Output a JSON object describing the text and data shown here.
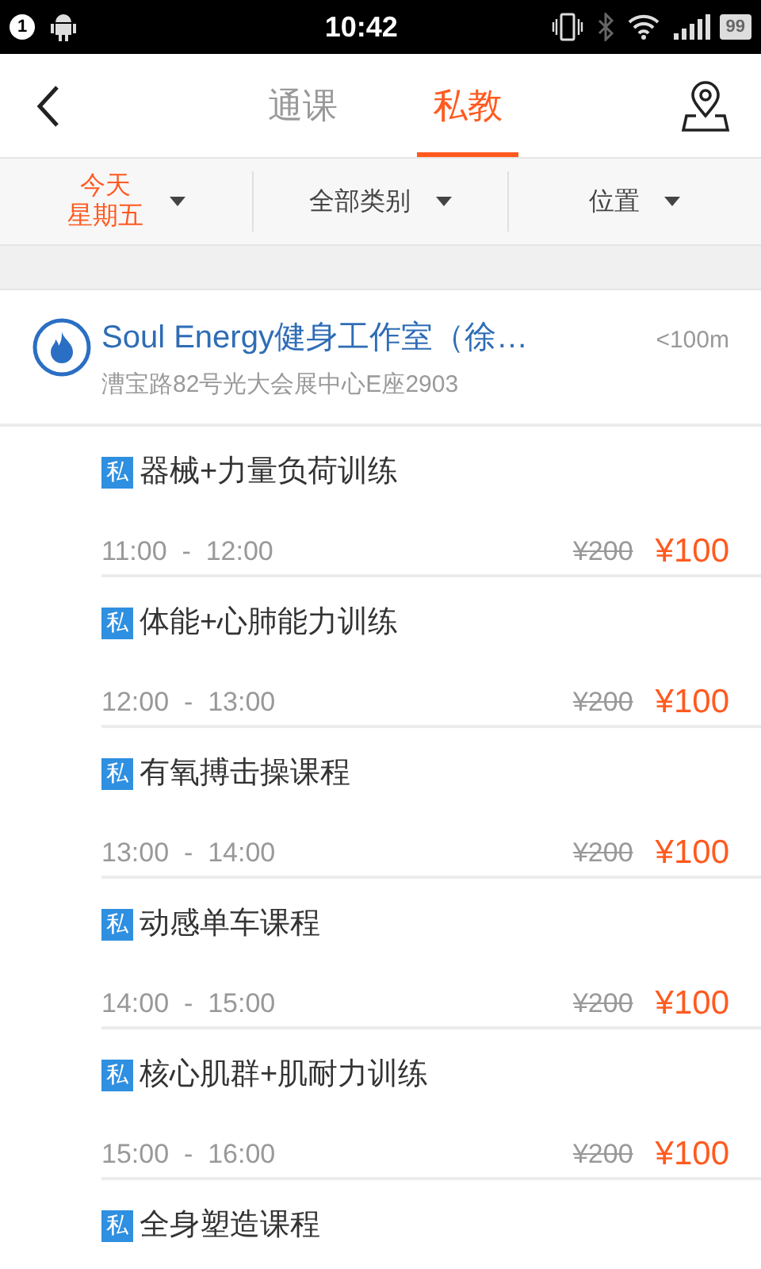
{
  "status_bar": {
    "notification_count": "1",
    "time": "10:42",
    "battery": "99"
  },
  "tabs": [
    {
      "label": "通课",
      "selected": false
    },
    {
      "label": "私教",
      "selected": true
    }
  ],
  "filters": [
    {
      "label": "今天",
      "sublabel": "星期五",
      "selected": true
    },
    {
      "label": "全部类别",
      "selected": false
    },
    {
      "label": "位置",
      "selected": false
    }
  ],
  "gym": {
    "name": "Soul Energy健身工作室（徐…",
    "address": "漕宝路82号光大会展中心E座2903",
    "distance": "<100m"
  },
  "courses": [
    {
      "tag": "私",
      "title": "器械+力量负荷训练",
      "time": "11:00  -  12:00",
      "original_price": "¥200",
      "price": "¥100"
    },
    {
      "tag": "私",
      "title": "体能+心肺能力训练",
      "time": "12:00  -  13:00",
      "original_price": "¥200",
      "price": "¥100"
    },
    {
      "tag": "私",
      "title": "有氧搏击操课程",
      "time": "13:00  -  14:00",
      "original_price": "¥200",
      "price": "¥100"
    },
    {
      "tag": "私",
      "title": "动感单车课程",
      "time": "14:00  -  15:00",
      "original_price": "¥200",
      "price": "¥100"
    },
    {
      "tag": "私",
      "title": "核心肌群+肌耐力训练",
      "time": "15:00  -  16:00",
      "original_price": "¥200",
      "price": "¥100"
    },
    {
      "tag": "私",
      "title": "全身塑造课程"
    }
  ]
}
